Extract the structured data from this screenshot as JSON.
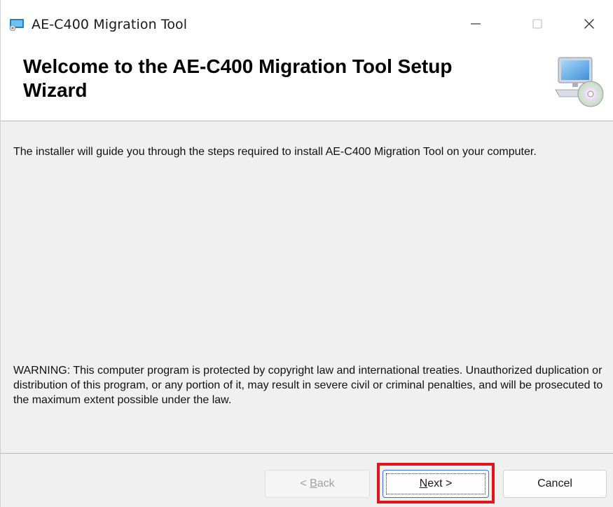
{
  "window": {
    "title": "AE-C400 Migration Tool",
    "app_icon": "installer-monitor-icon",
    "controls": {
      "minimize": "minimize-icon",
      "maximize": "maximize-icon",
      "close": "close-icon"
    }
  },
  "banner": {
    "title": "Welcome to the AE-C400 Migration Tool Setup Wizard",
    "icon": "computer-cd-icon"
  },
  "body": {
    "intro": "The installer will guide you through the steps required to install AE-C400 Migration Tool on your computer.",
    "warning": "WARNING: This computer program is protected by copyright law and international treaties. Unauthorized duplication or distribution of this program, or any portion of it, may result in severe civil or criminal penalties, and will be prosecuted to the maximum extent possible under the law."
  },
  "buttons": {
    "back": {
      "prefix": "< ",
      "accel": "B",
      "rest": "ack",
      "enabled": false
    },
    "next": {
      "accel": "N",
      "rest": "ext",
      "suffix": " >",
      "enabled": true
    },
    "cancel": {
      "label": "Cancel",
      "enabled": true
    }
  },
  "colors": {
    "highlight": "#e4141c",
    "focus_border": "#3b6fd6"
  }
}
